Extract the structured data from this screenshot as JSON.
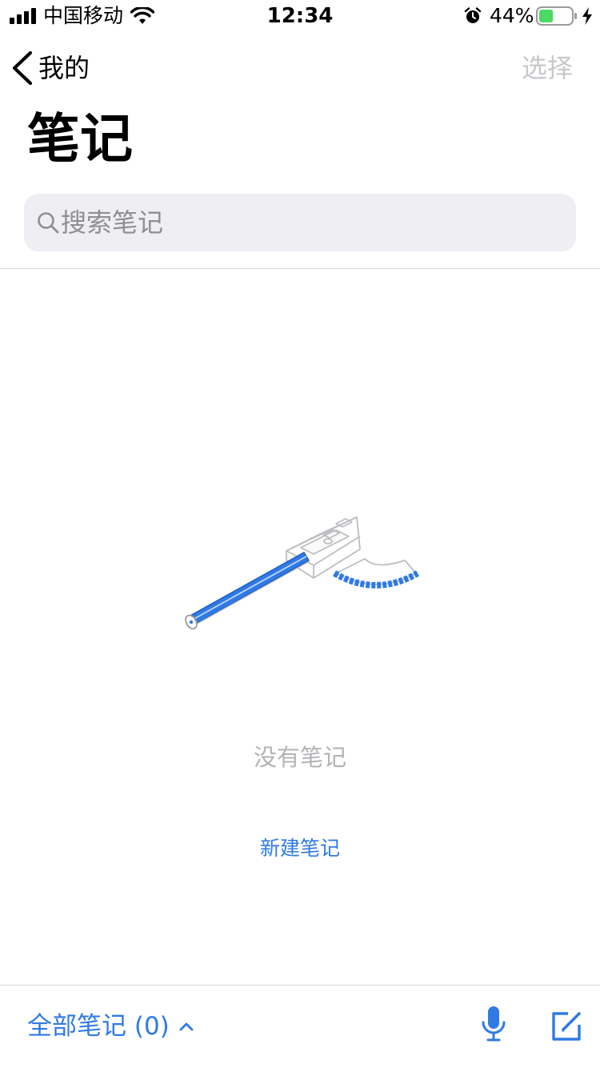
{
  "status_bar": {
    "carrier": "中国移动",
    "time": "12:34",
    "battery_percent": "44%",
    "battery_level": 0.44,
    "icons": [
      "signal-icon",
      "wifi-icon",
      "alarm-icon",
      "battery-icon",
      "charging-bolt-icon"
    ]
  },
  "nav": {
    "back_label": "我的",
    "select_label": "选择"
  },
  "page": {
    "title": "笔记"
  },
  "search": {
    "placeholder": "搜索笔记"
  },
  "empty_state": {
    "message": "没有笔记",
    "action_label": "新建笔记",
    "illustration": "pencil-sharpener-illustration"
  },
  "toolbar": {
    "folder_label": "全部笔记 (0)",
    "icons": [
      "chevron-up-icon",
      "microphone-icon",
      "compose-icon"
    ]
  },
  "colors": {
    "accent": "#2f7ae5",
    "muted_text": "#b3b3b8",
    "search_bg": "#eeeef3",
    "battery_fill": "#4cd964"
  }
}
